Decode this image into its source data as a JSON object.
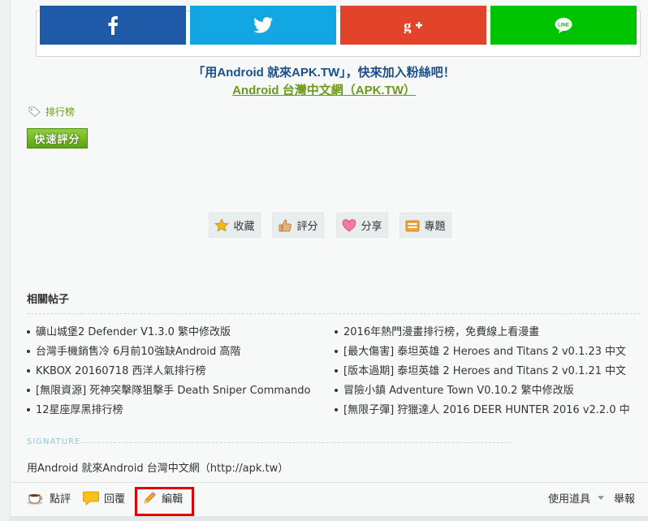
{
  "share": {
    "facebook": {
      "icon": "facebook-icon",
      "color": "#1f5aa8"
    },
    "twitter": {
      "icon": "twitter-icon",
      "color": "#12a7e3"
    },
    "googleplus": {
      "icon": "google-plus-icon",
      "color": "#e1432b"
    },
    "line": {
      "icon": "line-icon",
      "color": "#00c300"
    }
  },
  "promo": {
    "line1": "「用Android 就來APK.TW」，快來加入粉絲吧！",
    "line2": "Android 台灣中文網（APK.TW）"
  },
  "tag": {
    "label": "排行榜"
  },
  "quick_rate": {
    "label": "快速評分"
  },
  "actions": [
    {
      "label": "收藏",
      "icon": "star-icon"
    },
    {
      "label": "評分",
      "icon": "thumbs-up-icon"
    },
    {
      "label": "分享",
      "icon": "heart-icon"
    },
    {
      "label": "專題",
      "icon": "folder-icon"
    }
  ],
  "related": {
    "title": "相關帖子",
    "left": [
      "礦山城堡2 Defender V1.3.0 繁中修改版",
      "台灣手機銷售冷 6月前10強缺Android 高階",
      "KKBOX 20160718 西洋人氣排行榜",
      "[無限資源] 死神突擊隊狙擊手 Death Sniper Commando",
      "12星座厚黑排行榜"
    ],
    "right": [
      "2016年熱門漫畫排行榜，免費線上看漫畫",
      "[最大傷害] 泰坦英雄 2 Heroes and Titans 2 v0.1.23 中文",
      "[版本過期] 泰坦英雄 2 Heroes and Titans 2 v0.1.21 中文",
      "冒險小鎮 Adventure Town V0.10.2 繁中修改版",
      "[無限子彈] 狩獵達人 2016 DEER HUNTER 2016 v2.2.0 中"
    ]
  },
  "signature": {
    "label": "SIGNATURE",
    "text": "用Android 就來Android 台灣中文網（http://apk.tw）"
  },
  "footer": {
    "comment": "點評",
    "reply": "回覆",
    "edit": "編輯",
    "tools": "使用道具",
    "report": "舉報"
  },
  "colors": {
    "accent_green": "#6c9a1a",
    "title_blue": "#1a4f8c",
    "highlight_red": "#e00000"
  }
}
